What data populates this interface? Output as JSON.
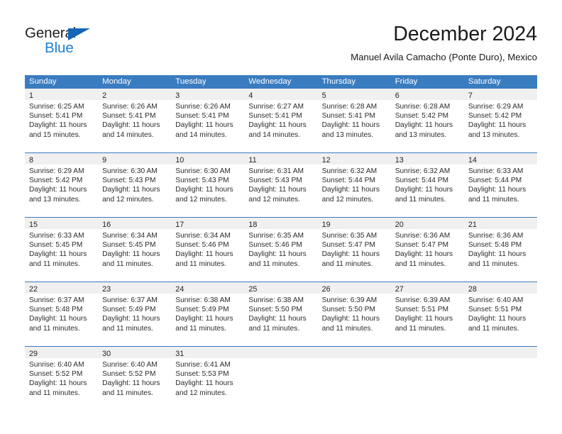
{
  "branding": {
    "logo_text_1": "General",
    "logo_text_2": "Blue",
    "logo_accent_color": "#1f7fd4",
    "logo_triangle_color": "#1565b8"
  },
  "header": {
    "title": "December 2024",
    "subtitle": "Manuel Avila Camacho (Ponte Duro), Mexico"
  },
  "calendar": {
    "header_background": "#3a7cc0",
    "day_number_background": "#f0f0f0",
    "weekdays": [
      "Sunday",
      "Monday",
      "Tuesday",
      "Wednesday",
      "Thursday",
      "Friday",
      "Saturday"
    ],
    "weeks": [
      [
        {
          "day": "1",
          "sunrise": "Sunrise: 6:25 AM",
          "sunset": "Sunset: 5:41 PM",
          "daylight_1": "Daylight: 11 hours",
          "daylight_2": "and 15 minutes."
        },
        {
          "day": "2",
          "sunrise": "Sunrise: 6:26 AM",
          "sunset": "Sunset: 5:41 PM",
          "daylight_1": "Daylight: 11 hours",
          "daylight_2": "and 14 minutes."
        },
        {
          "day": "3",
          "sunrise": "Sunrise: 6:26 AM",
          "sunset": "Sunset: 5:41 PM",
          "daylight_1": "Daylight: 11 hours",
          "daylight_2": "and 14 minutes."
        },
        {
          "day": "4",
          "sunrise": "Sunrise: 6:27 AM",
          "sunset": "Sunset: 5:41 PM",
          "daylight_1": "Daylight: 11 hours",
          "daylight_2": "and 14 minutes."
        },
        {
          "day": "5",
          "sunrise": "Sunrise: 6:28 AM",
          "sunset": "Sunset: 5:41 PM",
          "daylight_1": "Daylight: 11 hours",
          "daylight_2": "and 13 minutes."
        },
        {
          "day": "6",
          "sunrise": "Sunrise: 6:28 AM",
          "sunset": "Sunset: 5:42 PM",
          "daylight_1": "Daylight: 11 hours",
          "daylight_2": "and 13 minutes."
        },
        {
          "day": "7",
          "sunrise": "Sunrise: 6:29 AM",
          "sunset": "Sunset: 5:42 PM",
          "daylight_1": "Daylight: 11 hours",
          "daylight_2": "and 13 minutes."
        }
      ],
      [
        {
          "day": "8",
          "sunrise": "Sunrise: 6:29 AM",
          "sunset": "Sunset: 5:42 PM",
          "daylight_1": "Daylight: 11 hours",
          "daylight_2": "and 13 minutes."
        },
        {
          "day": "9",
          "sunrise": "Sunrise: 6:30 AM",
          "sunset": "Sunset: 5:43 PM",
          "daylight_1": "Daylight: 11 hours",
          "daylight_2": "and 12 minutes."
        },
        {
          "day": "10",
          "sunrise": "Sunrise: 6:30 AM",
          "sunset": "Sunset: 5:43 PM",
          "daylight_1": "Daylight: 11 hours",
          "daylight_2": "and 12 minutes."
        },
        {
          "day": "11",
          "sunrise": "Sunrise: 6:31 AM",
          "sunset": "Sunset: 5:43 PM",
          "daylight_1": "Daylight: 11 hours",
          "daylight_2": "and 12 minutes."
        },
        {
          "day": "12",
          "sunrise": "Sunrise: 6:32 AM",
          "sunset": "Sunset: 5:44 PM",
          "daylight_1": "Daylight: 11 hours",
          "daylight_2": "and 12 minutes."
        },
        {
          "day": "13",
          "sunrise": "Sunrise: 6:32 AM",
          "sunset": "Sunset: 5:44 PM",
          "daylight_1": "Daylight: 11 hours",
          "daylight_2": "and 11 minutes."
        },
        {
          "day": "14",
          "sunrise": "Sunrise: 6:33 AM",
          "sunset": "Sunset: 5:44 PM",
          "daylight_1": "Daylight: 11 hours",
          "daylight_2": "and 11 minutes."
        }
      ],
      [
        {
          "day": "15",
          "sunrise": "Sunrise: 6:33 AM",
          "sunset": "Sunset: 5:45 PM",
          "daylight_1": "Daylight: 11 hours",
          "daylight_2": "and 11 minutes."
        },
        {
          "day": "16",
          "sunrise": "Sunrise: 6:34 AM",
          "sunset": "Sunset: 5:45 PM",
          "daylight_1": "Daylight: 11 hours",
          "daylight_2": "and 11 minutes."
        },
        {
          "day": "17",
          "sunrise": "Sunrise: 6:34 AM",
          "sunset": "Sunset: 5:46 PM",
          "daylight_1": "Daylight: 11 hours",
          "daylight_2": "and 11 minutes."
        },
        {
          "day": "18",
          "sunrise": "Sunrise: 6:35 AM",
          "sunset": "Sunset: 5:46 PM",
          "daylight_1": "Daylight: 11 hours",
          "daylight_2": "and 11 minutes."
        },
        {
          "day": "19",
          "sunrise": "Sunrise: 6:35 AM",
          "sunset": "Sunset: 5:47 PM",
          "daylight_1": "Daylight: 11 hours",
          "daylight_2": "and 11 minutes."
        },
        {
          "day": "20",
          "sunrise": "Sunrise: 6:36 AM",
          "sunset": "Sunset: 5:47 PM",
          "daylight_1": "Daylight: 11 hours",
          "daylight_2": "and 11 minutes."
        },
        {
          "day": "21",
          "sunrise": "Sunrise: 6:36 AM",
          "sunset": "Sunset: 5:48 PM",
          "daylight_1": "Daylight: 11 hours",
          "daylight_2": "and 11 minutes."
        }
      ],
      [
        {
          "day": "22",
          "sunrise": "Sunrise: 6:37 AM",
          "sunset": "Sunset: 5:48 PM",
          "daylight_1": "Daylight: 11 hours",
          "daylight_2": "and 11 minutes."
        },
        {
          "day": "23",
          "sunrise": "Sunrise: 6:37 AM",
          "sunset": "Sunset: 5:49 PM",
          "daylight_1": "Daylight: 11 hours",
          "daylight_2": "and 11 minutes."
        },
        {
          "day": "24",
          "sunrise": "Sunrise: 6:38 AM",
          "sunset": "Sunset: 5:49 PM",
          "daylight_1": "Daylight: 11 hours",
          "daylight_2": "and 11 minutes."
        },
        {
          "day": "25",
          "sunrise": "Sunrise: 6:38 AM",
          "sunset": "Sunset: 5:50 PM",
          "daylight_1": "Daylight: 11 hours",
          "daylight_2": "and 11 minutes."
        },
        {
          "day": "26",
          "sunrise": "Sunrise: 6:39 AM",
          "sunset": "Sunset: 5:50 PM",
          "daylight_1": "Daylight: 11 hours",
          "daylight_2": "and 11 minutes."
        },
        {
          "day": "27",
          "sunrise": "Sunrise: 6:39 AM",
          "sunset": "Sunset: 5:51 PM",
          "daylight_1": "Daylight: 11 hours",
          "daylight_2": "and 11 minutes."
        },
        {
          "day": "28",
          "sunrise": "Sunrise: 6:40 AM",
          "sunset": "Sunset: 5:51 PM",
          "daylight_1": "Daylight: 11 hours",
          "daylight_2": "and 11 minutes."
        }
      ],
      [
        {
          "day": "29",
          "sunrise": "Sunrise: 6:40 AM",
          "sunset": "Sunset: 5:52 PM",
          "daylight_1": "Daylight: 11 hours",
          "daylight_2": "and 11 minutes."
        },
        {
          "day": "30",
          "sunrise": "Sunrise: 6:40 AM",
          "sunset": "Sunset: 5:52 PM",
          "daylight_1": "Daylight: 11 hours",
          "daylight_2": "and 11 minutes."
        },
        {
          "day": "31",
          "sunrise": "Sunrise: 6:41 AM",
          "sunset": "Sunset: 5:53 PM",
          "daylight_1": "Daylight: 11 hours",
          "daylight_2": "and 12 minutes."
        },
        {
          "day": "",
          "sunrise": "",
          "sunset": "",
          "daylight_1": "",
          "daylight_2": ""
        },
        {
          "day": "",
          "sunrise": "",
          "sunset": "",
          "daylight_1": "",
          "daylight_2": ""
        },
        {
          "day": "",
          "sunrise": "",
          "sunset": "",
          "daylight_1": "",
          "daylight_2": ""
        },
        {
          "day": "",
          "sunrise": "",
          "sunset": "",
          "daylight_1": "",
          "daylight_2": ""
        }
      ]
    ]
  }
}
